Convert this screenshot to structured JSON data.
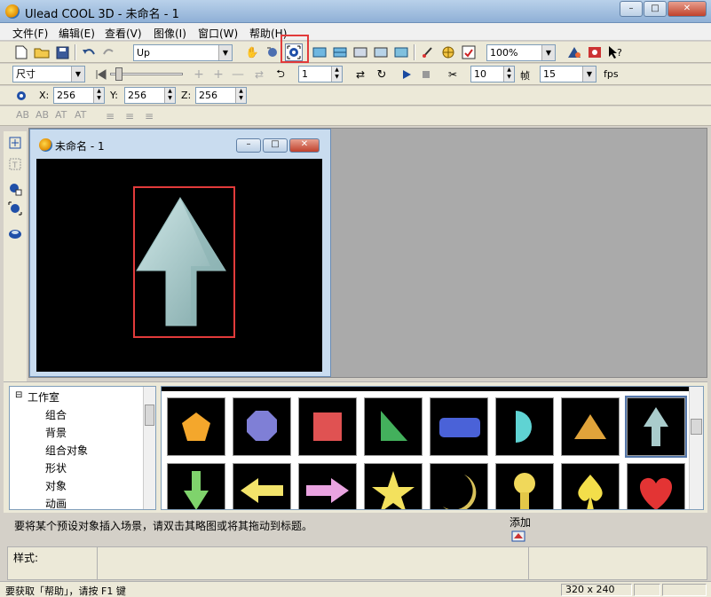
{
  "window": {
    "title": "Ulead COOL 3D - 未命名 - 1",
    "min": "–",
    "max": "□",
    "close": "✕"
  },
  "menu": [
    "文件(F)",
    "编辑(E)",
    "查看(V)",
    "图像(I)",
    "窗口(W)",
    "帮助(H)"
  ],
  "toolbar1": {
    "object_combo": "Up",
    "zoom_combo": "100%"
  },
  "toolbar2": {
    "property_combo": "尺寸",
    "frame_value": "1",
    "fps_frames": "10",
    "frame_unit": "帧",
    "fps_value": "15",
    "fps_label": "fps"
  },
  "toolbar3": {
    "x_label": "X:",
    "x_value": "256",
    "y_label": "Y:",
    "y_value": "256",
    "z_label": "Z:",
    "z_value": "256"
  },
  "text_toolbar": [
    "AB",
    "AB",
    "AT",
    "AT"
  ],
  "document": {
    "title": "未命名 - 1"
  },
  "library": {
    "tree": [
      "工作室",
      "组合",
      "背景",
      "组合对象",
      "形状",
      "对象",
      "动画"
    ],
    "thumbs_row1": [
      "pentagon",
      "octagon",
      "square",
      "triangle-right",
      "rounded-rect",
      "half-circle",
      "triangle",
      "arrow-up"
    ],
    "thumbs_row2": [
      "arrow-down",
      "arrow-left",
      "arrow-right",
      "star",
      "crescent",
      "bulb",
      "spade",
      "heart"
    ]
  },
  "hint": "要将某个预设对象插入场景，请双击其略图或将其拖动到标题。",
  "add_label": "添加",
  "style_label": "样式:",
  "status": {
    "help": "要获取「帮助」，请按 F1 键",
    "size": "320 x 240"
  },
  "colors": {
    "highlight": "#e23b3b",
    "arrow": "#a9cccc"
  }
}
